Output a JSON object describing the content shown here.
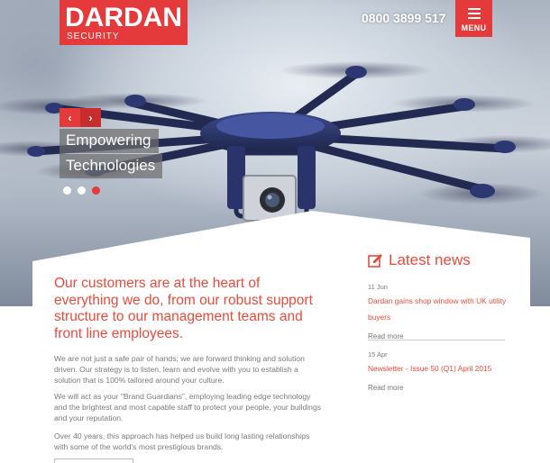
{
  "brand": {
    "name": "DARDAN",
    "tagline": "SECURITY",
    "accent": "#e43a3c"
  },
  "header": {
    "phone": "0800 3899 517",
    "menu_label": "MENU",
    "menu_icon": "hamburger-icon"
  },
  "slider": {
    "prev_icon": "chevron-left-icon",
    "next_icon": "chevron-right-icon",
    "caption_line1": "Empowering",
    "caption_line2": "Technologies",
    "dots": 3,
    "active_dot": 3
  },
  "intro": {
    "headline": "Our customers are at the heart of everything we do, from our robust support structure to our management teams and front line employees.",
    "paragraph1": "We are not just a safe pair of hands; we are forward thinking and solution driven. Our strategy is to listen, learn and evolve with you to establish a solution that is 100% tailored around your culture.",
    "paragraph2": "We will act as your \"Brand Guardians\", employing leading edge technology and the brightest and most capable staff to protect your people, your buildings and your reputation.",
    "paragraph3": "Over 40 years, this approach has helped us build long lasting relationships with some of the world's most prestigious brands."
  },
  "news": {
    "heading": "Latest news",
    "icon": "edit-icon",
    "items": [
      {
        "date": "11 Jun",
        "title": "Dardan gains shop window with UK utility buyers",
        "more": "Read more"
      },
      {
        "date": "15 Apr",
        "title": "Newsletter - Issue 50 (Q1) April 2015",
        "more": "Read more"
      }
    ]
  }
}
